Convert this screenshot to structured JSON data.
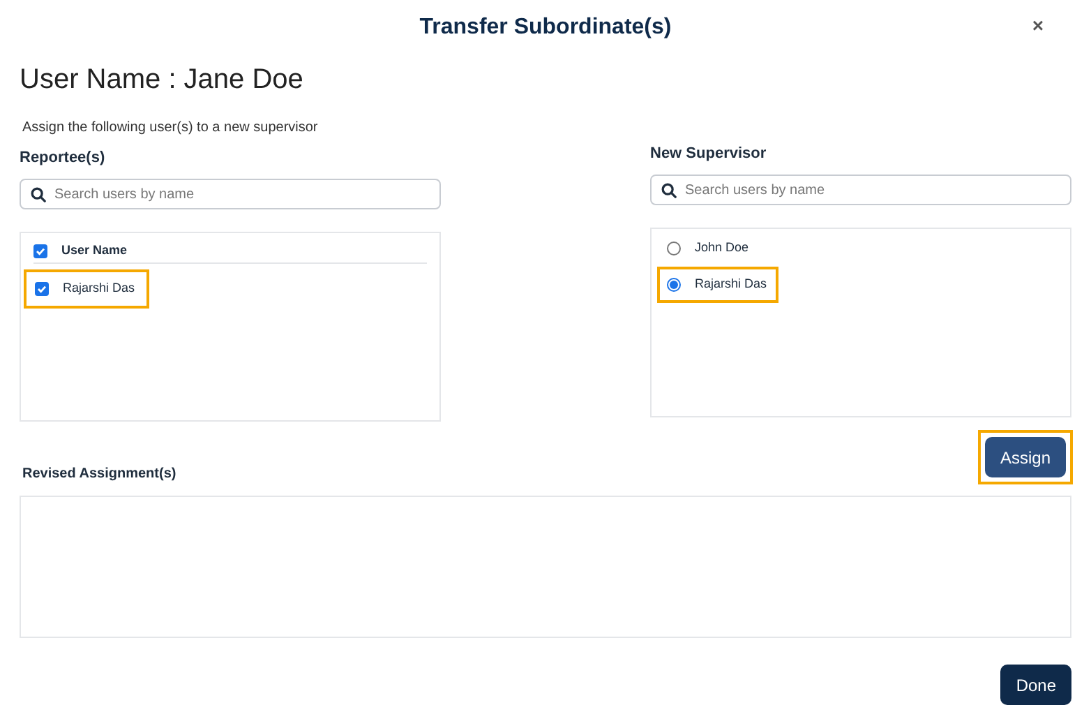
{
  "dialog": {
    "title": "Transfer Subordinate(s)",
    "close": "×"
  },
  "heading": "User Name : Jane Doe",
  "instruction": "Assign the following user(s) to a new supervisor",
  "reportees": {
    "label": "Reportee(s)",
    "search": {
      "placeholder": "Search users by name"
    },
    "header": {
      "label": "User Name",
      "checked": true
    },
    "rows": [
      {
        "name": "Rajarshi Das",
        "checked": true,
        "highlighted": true
      }
    ]
  },
  "new_supervisor": {
    "label": "New Supervisor",
    "search": {
      "placeholder": "Search users by name"
    },
    "options": [
      {
        "name": "John Doe",
        "selected": false,
        "highlighted": false
      },
      {
        "name": "Rajarshi Das",
        "selected": true,
        "highlighted": true
      }
    ]
  },
  "assign_button": {
    "label": "Assign",
    "highlighted": true
  },
  "revised": {
    "label": "Revised Assignment(s)"
  },
  "done_button": {
    "label": "Done"
  }
}
